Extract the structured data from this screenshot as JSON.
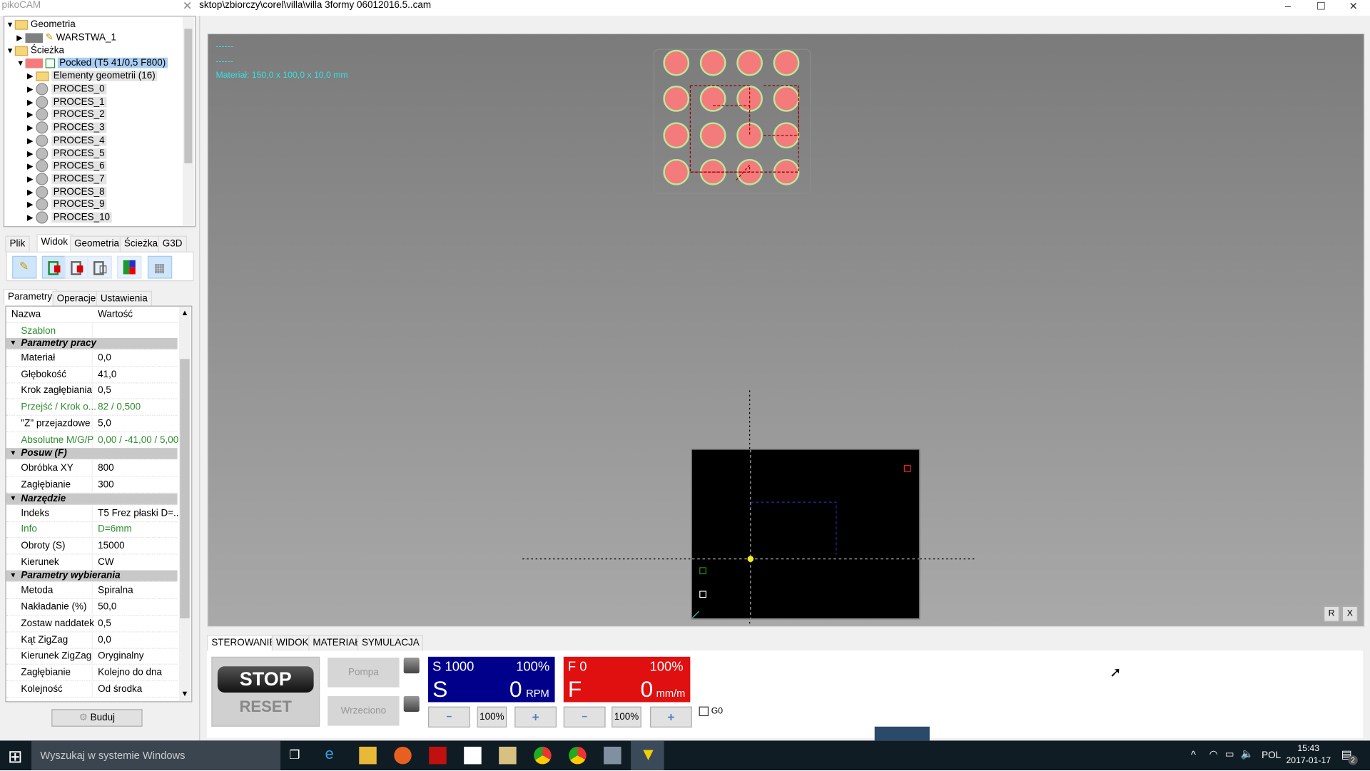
{
  "window": {
    "app_name": "pikoCAM",
    "file_path": "sktop\\zbiorczy\\corel\\villa\\villa 3formy 06012016.5..cam",
    "minimize": "–",
    "maximize": "☐",
    "close": "✕"
  },
  "tree": {
    "geometria": "Geometria",
    "warstwa": "WARSTWA_1",
    "sciezka": "Ścieżka",
    "pocked": "Pocked (T5 41/0,5 F800)",
    "elementy": "Elementy geometrii (16)",
    "procesy": [
      "PROCES_0",
      "PROCES_1",
      "PROCES_2",
      "PROCES_3",
      "PROCES_4",
      "PROCES_5",
      "PROCES_6",
      "PROCES_7",
      "PROCES_8",
      "PROCES_9",
      "PROCES_10"
    ]
  },
  "ribbon_tabs": [
    "Plik",
    "Widok",
    "Geometria",
    "Ścieżka",
    "G3D"
  ],
  "ribbon_active": "Widok",
  "panel_tabs": [
    "Parametry",
    "Operacje",
    "Ustawienia"
  ],
  "grid": {
    "col_name": "Nazwa",
    "col_value": "Wartość",
    "rows": [
      {
        "name": "Szablon",
        "value": "",
        "type": "green"
      },
      {
        "name": "Parametry pracy",
        "type": "cat"
      },
      {
        "name": "Materiał",
        "value": "0,0"
      },
      {
        "name": "Głębokość",
        "value": "41,0"
      },
      {
        "name": "Krok zagłębiania",
        "value": "0,5"
      },
      {
        "name": "Przejść / Krok o...",
        "value": "82 / 0,500",
        "type": "green"
      },
      {
        "name": "\"Z\" przejazdowe",
        "value": "5,0"
      },
      {
        "name": "Absolutne M/G/P",
        "value": "0,00 / -41,00 / 5,00",
        "type": "green"
      },
      {
        "name": "Posuw (F)",
        "type": "cat"
      },
      {
        "name": "Obróbka XY",
        "value": "800"
      },
      {
        "name": "Zagłębianie",
        "value": "300"
      },
      {
        "name": "Narzędzie",
        "type": "cat"
      },
      {
        "name": "Indeks",
        "value": "T5 Frez płaski D=..."
      },
      {
        "name": "Info",
        "value": "D=6mm",
        "type": "green"
      },
      {
        "name": "Obroty (S)",
        "value": "15000"
      },
      {
        "name": "Kierunek",
        "value": "CW"
      },
      {
        "name": "Parametry wybierania",
        "type": "cat"
      },
      {
        "name": "Metoda",
        "value": "Spiralna"
      },
      {
        "name": "Nakładanie (%)",
        "value": "50,0"
      },
      {
        "name": "Zostaw naddatek",
        "value": "0,5"
      },
      {
        "name": "Kąt ZigZag",
        "value": "0,0"
      },
      {
        "name": "Kierunek ZigZag",
        "value": "Oryginalny"
      },
      {
        "name": "Zagłębianie",
        "value": "Kolejno do dna"
      },
      {
        "name": "Kolejność",
        "value": "Od środka"
      }
    ]
  },
  "build_button": "Buduj",
  "viewport": {
    "line1": "------",
    "line2": "------",
    "material": "Materiał: 150,0 x 100,0 x 10,0 mm",
    "btn_r": "R",
    "btn_x": "X"
  },
  "bottom_tabs": [
    "STEROWANIE",
    "WIDOK",
    "MATERIAŁ",
    "SYMULACJA / NARZĘDZIA"
  ],
  "control": {
    "stop": "STOP",
    "reset": "RESET",
    "pompa": "Pompa",
    "wrzeciono": "Wrzeciono",
    "spindle": {
      "set": "S 1000",
      "pct": "100%",
      "letter": "S",
      "value": "0",
      "unit": "RPM",
      "color": "#00008b"
    },
    "feed": {
      "set": "F 0",
      "pct": "100%",
      "letter": "F",
      "value": "0",
      "unit": "mm/m",
      "color": "#e01010"
    },
    "minus": "−",
    "plus": "+",
    "pct_btn": "100%",
    "g0": "G0",
    "g0_checked": false
  },
  "taskbar": {
    "search": "Wyszukaj w systemie Windows",
    "lang": "POL",
    "time": "15:43",
    "date": "2017-01-17",
    "notifications": "2"
  }
}
